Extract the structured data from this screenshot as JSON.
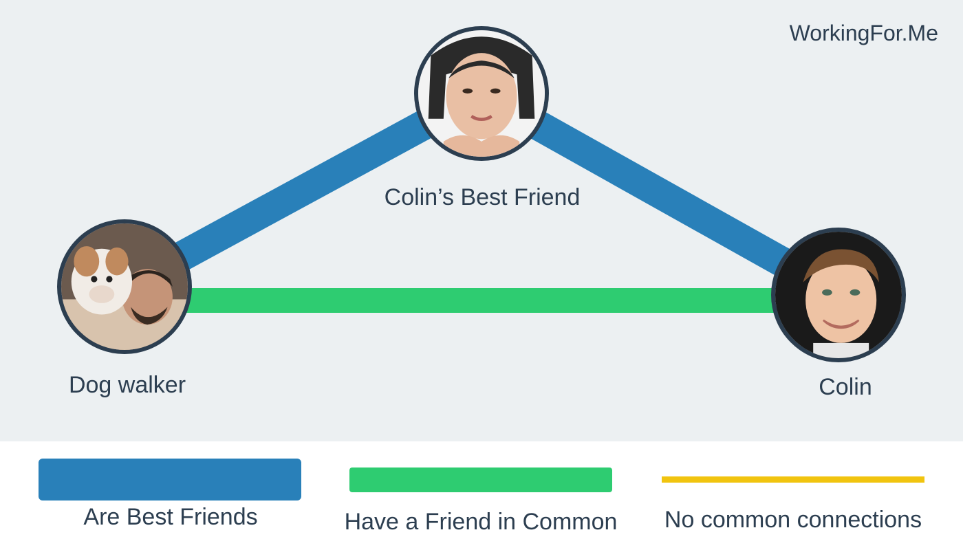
{
  "brand": "WorkingFor.Me",
  "colors": {
    "best_friends": "#2980b9",
    "friend_in_common": "#2ecc71",
    "no_common": "#f1c40f",
    "node_border": "#2c3e50",
    "background": "#ecf0f2"
  },
  "nodes": {
    "best_friend": {
      "label": "Colin’s Best Friend",
      "avatar": "woman-photo"
    },
    "dog_walker": {
      "label": "Dog walker",
      "avatar": "man-with-bulldog-photo"
    },
    "colin": {
      "label": "Colin",
      "avatar": "young-man-photo"
    }
  },
  "edges": [
    {
      "from": "dog_walker",
      "to": "best_friend",
      "type": "best_friends"
    },
    {
      "from": "best_friend",
      "to": "colin",
      "type": "best_friends"
    },
    {
      "from": "dog_walker",
      "to": "colin",
      "type": "friend_in_common"
    }
  ],
  "legend": {
    "best_friends": "Are Best Friends",
    "friend_in_common": "Have a Friend in Common",
    "no_common": "No common connections"
  }
}
